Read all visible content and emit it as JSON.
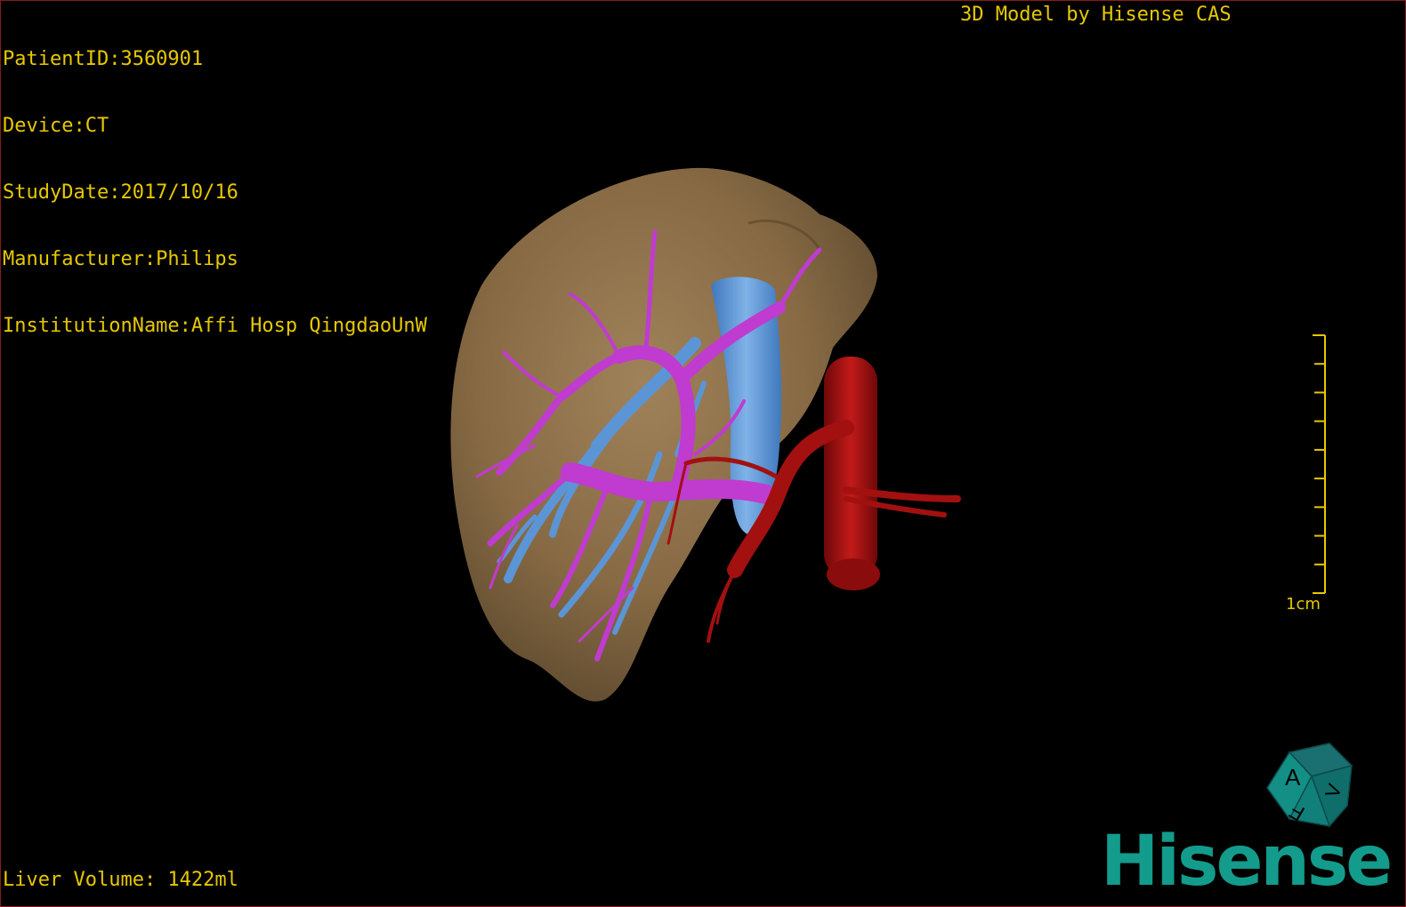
{
  "patient_info": {
    "patient_id": "PatientID:3560901",
    "device": "Device:CT",
    "study_date": "StudyDate:2017/10/16",
    "manufacturer": "Manufacturer:Philips",
    "institution": "InstitutionName:Affi Hosp QingdaoUnW"
  },
  "credit": "3D Model by Hisense CAS",
  "liver_volume": "Liver Volume: 1422ml",
  "scale": {
    "label": "1cm",
    "ticks": 10
  },
  "orientation_cube": {
    "face_top": "A",
    "face_side": "F",
    "face_right": "V"
  },
  "brand": "Hisense",
  "colors": {
    "overlay_text": "#e6c800",
    "liver": "#8a6d45",
    "portal_vein": "#c03bd0",
    "hepatic_vein": "#5b95d6",
    "artery": "#a31010",
    "brand": "#139b8c"
  }
}
